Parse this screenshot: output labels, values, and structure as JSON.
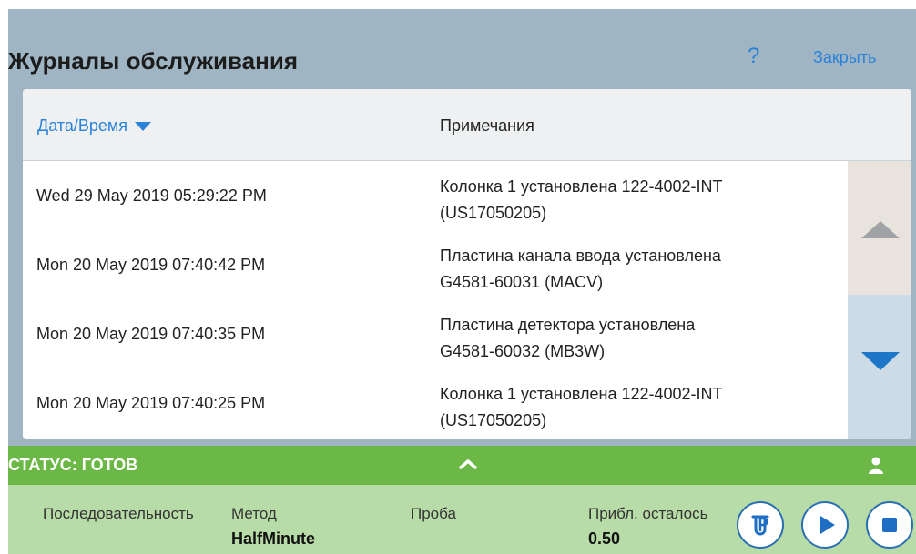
{
  "header": {
    "title": "Журналы обслуживания",
    "help_label": "?",
    "close_label": "Закрыть"
  },
  "table": {
    "columns": {
      "date": "Дата/Время",
      "notes": "Примечания"
    },
    "sort": "descending",
    "rows": [
      {
        "date": "Wed 29 May 2019 05:29:22 PM",
        "note_line1": "Колонка 1 установлена 122-4002-INT",
        "note_line2": "(US17050205)"
      },
      {
        "date": "Mon 20 May 2019 07:40:42 PM",
        "note_line1": "Пластина канала ввода установлена",
        "note_line2": "G4581-60031 (MACV)"
      },
      {
        "date": "Mon 20 May 2019 07:40:35 PM",
        "note_line1": "Пластина детектора установлена",
        "note_line2": "G4581-60032 (MB3W)"
      },
      {
        "date": "Mon 20 May 2019 07:40:25 PM",
        "note_line1": "Колонка 1 установлена 122-4002-INT",
        "note_line2": "(US17050205)"
      }
    ]
  },
  "status": {
    "text": "СТАТУС: ГОТОВ",
    "toggle_icon": "chevron-up-icon",
    "user_icon": "user-icon"
  },
  "info": {
    "sequence_label": "Последовательность",
    "method_label": "Метод",
    "method_value": "HalfMinute",
    "sample_label": "Проба",
    "remaining_label": "Прибл. осталось",
    "remaining_value": "0.50"
  },
  "controls": {
    "vial_icon": "vial-icon",
    "play_icon": "play-icon",
    "stop_icon": "stop-icon"
  },
  "colors": {
    "header_bg": "#9fb5c4",
    "accent": "#2a82d8",
    "status_bg": "#6cb846",
    "info_bg": "#b8dca7"
  }
}
